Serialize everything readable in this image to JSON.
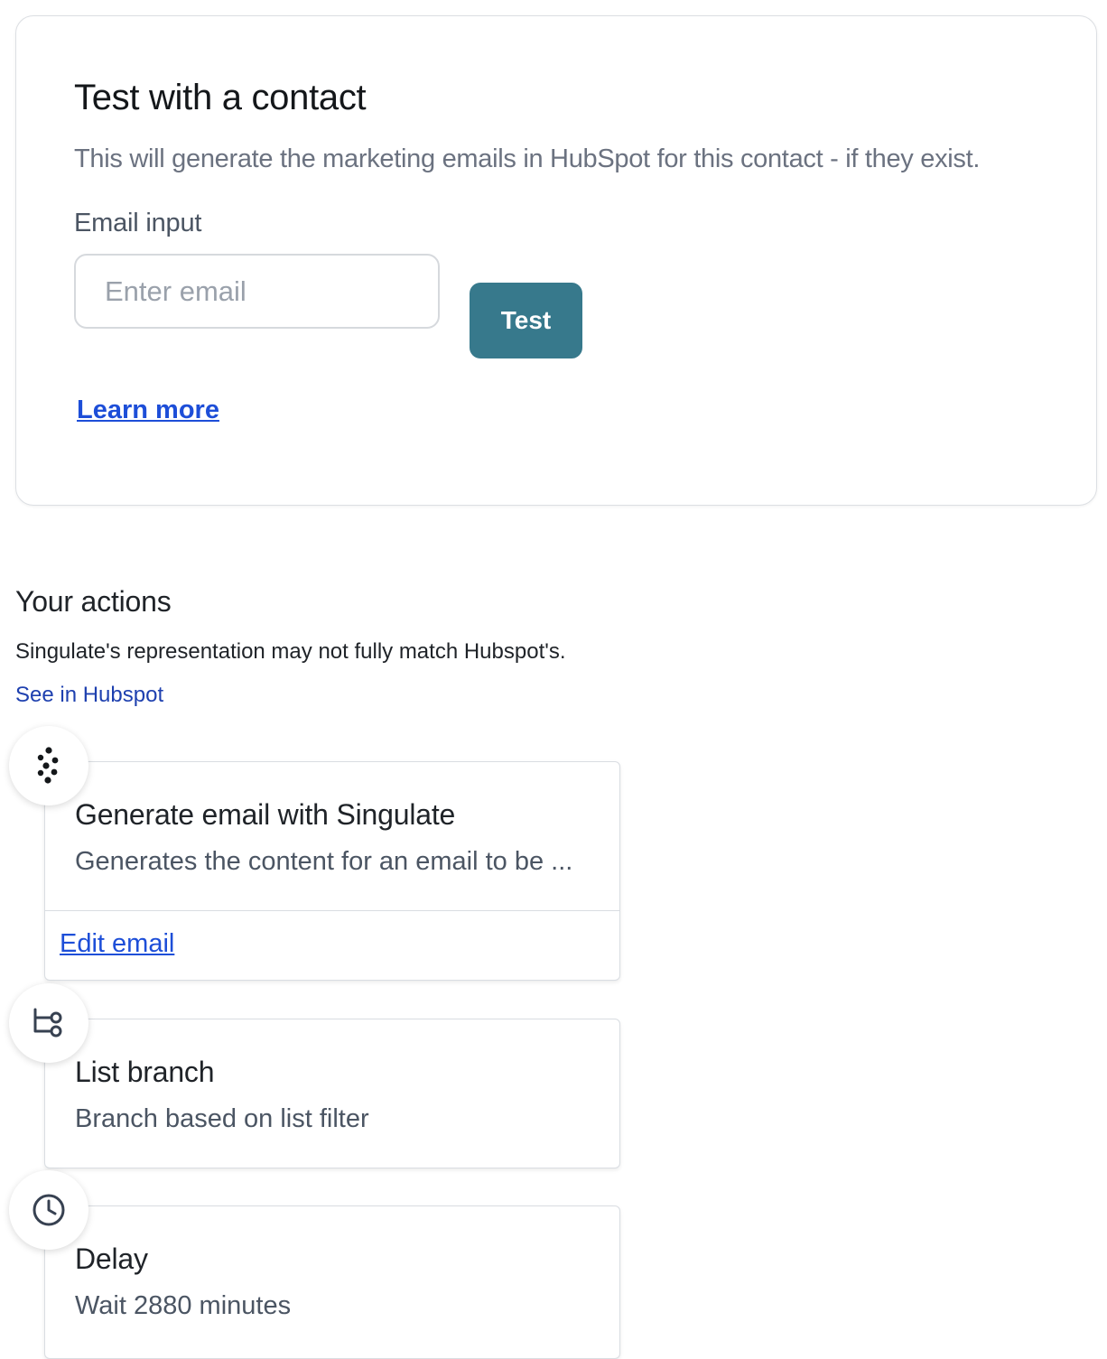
{
  "test_card": {
    "title": "Test with a contact",
    "description": "This will generate the marketing emails in HubSpot for this contact - if they exist.",
    "email_label": "Email input",
    "email_placeholder": "Enter email",
    "email_value": "",
    "test_button_label": "Test",
    "learn_more_label": "Learn more"
  },
  "actions": {
    "title": "Your actions",
    "note": "Singulate's representation may not fully match Hubspot's.",
    "see_in_hubspot_label": "See in Hubspot",
    "items": [
      {
        "icon": "singulate-logo-icon",
        "title": "Generate email with Singulate",
        "description": "Generates the content for an email to be ...",
        "link_label": "Edit email"
      },
      {
        "icon": "branch-icon",
        "title": "List branch",
        "description": "Branch based on list filter"
      },
      {
        "icon": "clock-icon",
        "title": "Delay",
        "description": "Wait 2880 minutes"
      }
    ]
  },
  "colors": {
    "button_bg": "#37798c",
    "link": "#1d4ed8",
    "secondary_link": "#1e40af",
    "muted_text": "#6b7280"
  }
}
